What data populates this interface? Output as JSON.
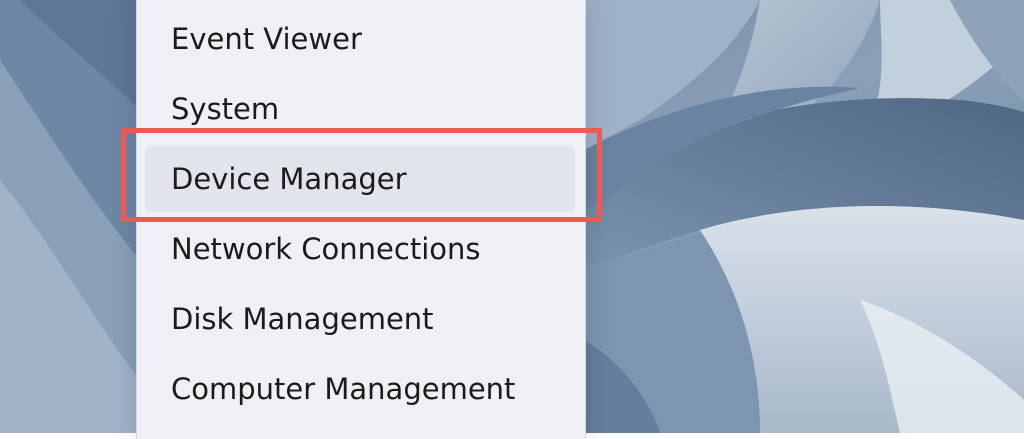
{
  "menu": {
    "items": [
      {
        "label": "Event Viewer"
      },
      {
        "label": "System"
      },
      {
        "label": "Device Manager",
        "hovered": true
      },
      {
        "label": "Network Connections"
      },
      {
        "label": "Disk Management"
      },
      {
        "label": "Computer Management"
      }
    ]
  },
  "colors": {
    "highlight_border": "#ec5b53",
    "menu_background": "#eef0f5",
    "hover_background": "#e1e4ea",
    "wallpaper_base": "#7f95ae"
  },
  "annotation": {
    "highlighted_item": "Device Manager"
  }
}
